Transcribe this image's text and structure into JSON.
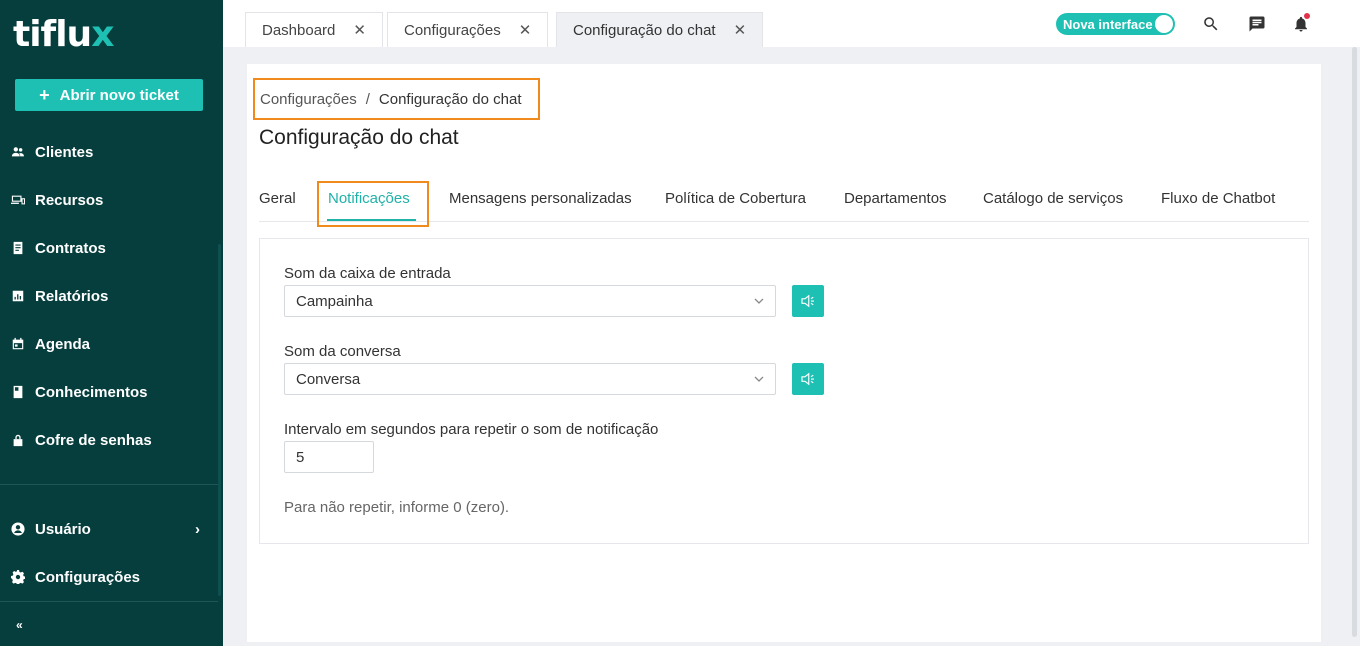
{
  "sidebar": {
    "logo": {
      "main": "tiflu",
      "accent": "x"
    },
    "new_ticket_label": "Abrir novo ticket",
    "items": [
      {
        "label": "Clientes",
        "icon": "users-icon"
      },
      {
        "label": "Recursos",
        "icon": "devices-icon"
      },
      {
        "label": "Contratos",
        "icon": "contract-icon"
      },
      {
        "label": "Relatórios",
        "icon": "report-icon"
      },
      {
        "label": "Agenda",
        "icon": "calendar-icon"
      },
      {
        "label": "Conhecimentos",
        "icon": "book-icon"
      },
      {
        "label": "Cofre de senhas",
        "icon": "lock-icon"
      }
    ],
    "user_label": "Usuário",
    "settings_label": "Configurações",
    "collapse_glyph": "«"
  },
  "topbar": {
    "tabs": [
      {
        "label": "Dashboard"
      },
      {
        "label": "Configurações"
      },
      {
        "label": "Configuração do chat"
      }
    ],
    "toggle_label": "Nova interface"
  },
  "breadcrumb": {
    "parent": "Configurações",
    "separator": "/",
    "current": "Configuração do chat"
  },
  "page": {
    "title": "Configuração do chat",
    "tabs": [
      "Geral",
      "Notificações",
      "Mensagens personalizadas",
      "Política de Cobertura",
      "Departamentos",
      "Catálogo de serviços",
      "Fluxo de Chatbot"
    ],
    "active_tab": "Notificações"
  },
  "form": {
    "inbox_sound_label": "Som da caixa de entrada",
    "inbox_sound_value": "Campainha",
    "conversation_sound_label": "Som da conversa",
    "conversation_sound_value": "Conversa",
    "interval_label": "Intervalo em segundos para repetir o som de notificação",
    "interval_value": "5",
    "hint": "Para não repetir, informe 0 (zero)."
  },
  "colors": {
    "sidebar_bg": "#063d3d",
    "accent": "#1fc0b4",
    "highlight_border": "#f08a1c",
    "notification_dot": "#e0334a"
  }
}
